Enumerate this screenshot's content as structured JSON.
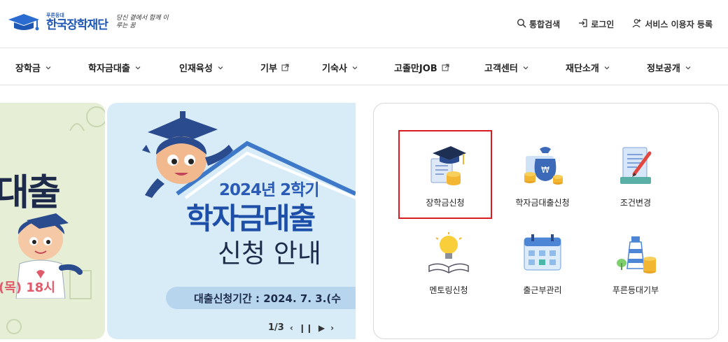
{
  "header": {
    "logo_sub": "푸른등대",
    "logo_name": "한국장학재단",
    "logo_slogan": "당신 곁에서 함께 이루는 꿈",
    "utility": [
      {
        "label": "통합검색",
        "icon": "search-icon"
      },
      {
        "label": "로그인",
        "icon": "login-icon"
      },
      {
        "label": "서비스 이용자 등록",
        "icon": "user-add-icon"
      }
    ]
  },
  "nav": {
    "items": [
      {
        "label": "장학금",
        "icon": "chevron-down-icon"
      },
      {
        "label": "학자금대출",
        "icon": "chevron-down-icon"
      },
      {
        "label": "인재육성",
        "icon": "chevron-down-icon"
      },
      {
        "label": "기부",
        "icon": "external-link-icon"
      },
      {
        "label": "기숙사",
        "icon": "chevron-down-icon"
      },
      {
        "label": "고졸만JOB",
        "icon": "external-link-icon"
      },
      {
        "label": "고객센터",
        "icon": "chevron-down-icon"
      },
      {
        "label": "재단소개",
        "icon": "chevron-down-icon"
      },
      {
        "label": "정보공개",
        "icon": "chevron-down-icon"
      }
    ]
  },
  "banner": {
    "prev_slide_text": "대출",
    "prev_slide_date": "(목) 18시",
    "title_line1": "2024년 2학기",
    "title_line2": "학자금대출",
    "title_line3": "신청 안내",
    "period": "대출신청기간 : 2024. 7. 3.(수",
    "pager": "1/3",
    "controls": [
      "‹",
      "❙❙",
      "▶",
      "›"
    ]
  },
  "quick_services": [
    {
      "label": "장학금신청",
      "icon": "graduation-cap-icon",
      "highlighted": true
    },
    {
      "label": "학자금대출신청",
      "icon": "money-bag-icon",
      "highlighted": false
    },
    {
      "label": "조건변경",
      "icon": "document-edit-icon",
      "highlighted": false
    },
    {
      "label": "멘토링신청",
      "icon": "lightbulb-book-icon",
      "highlighted": false
    },
    {
      "label": "출근부관리",
      "icon": "calendar-icon",
      "highlighted": false
    },
    {
      "label": "푸른등대기부",
      "icon": "lighthouse-coins-icon",
      "highlighted": false
    }
  ],
  "colors": {
    "brand": "#1f57b4",
    "highlight_border": "#d91c22",
    "banner_bg": "#d8ecf8",
    "prev_banner_bg": "#e6eed5"
  }
}
